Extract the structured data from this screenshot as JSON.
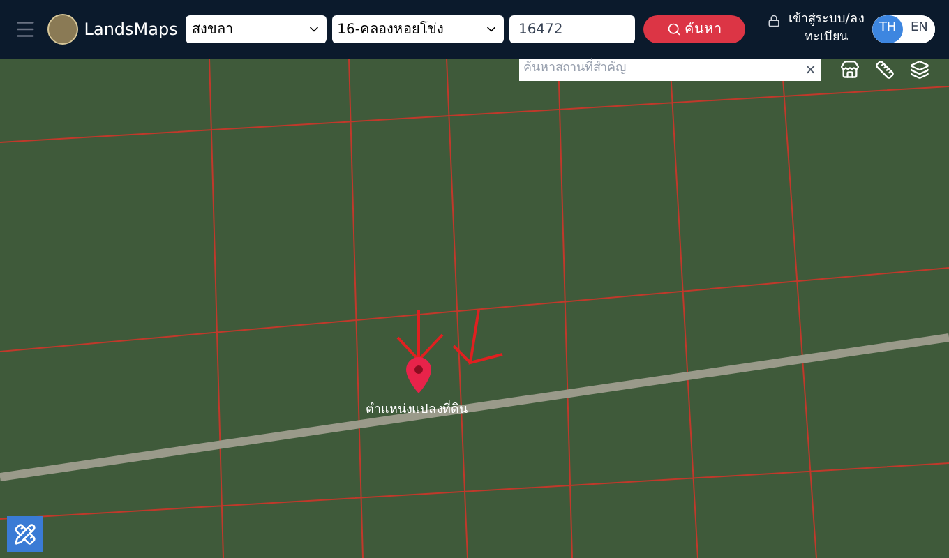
{
  "header": {
    "brand": "LandsMaps",
    "province": {
      "value": "สงขลา"
    },
    "district": {
      "value": "16-คลองหอยโข่ง"
    },
    "parcel_number": {
      "value": "16472"
    },
    "search_button": "ค้นหา",
    "login_link": "เข้าสู่ระบบ/ลงทะเบียน",
    "languages": [
      {
        "label": "TH",
        "selected": true
      },
      {
        "label": "EN",
        "selected": false
      }
    ]
  },
  "map": {
    "place_search": {
      "placeholder": "ค้นหาสถานที่สำคัญ",
      "clear": "×"
    },
    "marker_label": "ตำแหน่งแปลงที่ดิน"
  }
}
